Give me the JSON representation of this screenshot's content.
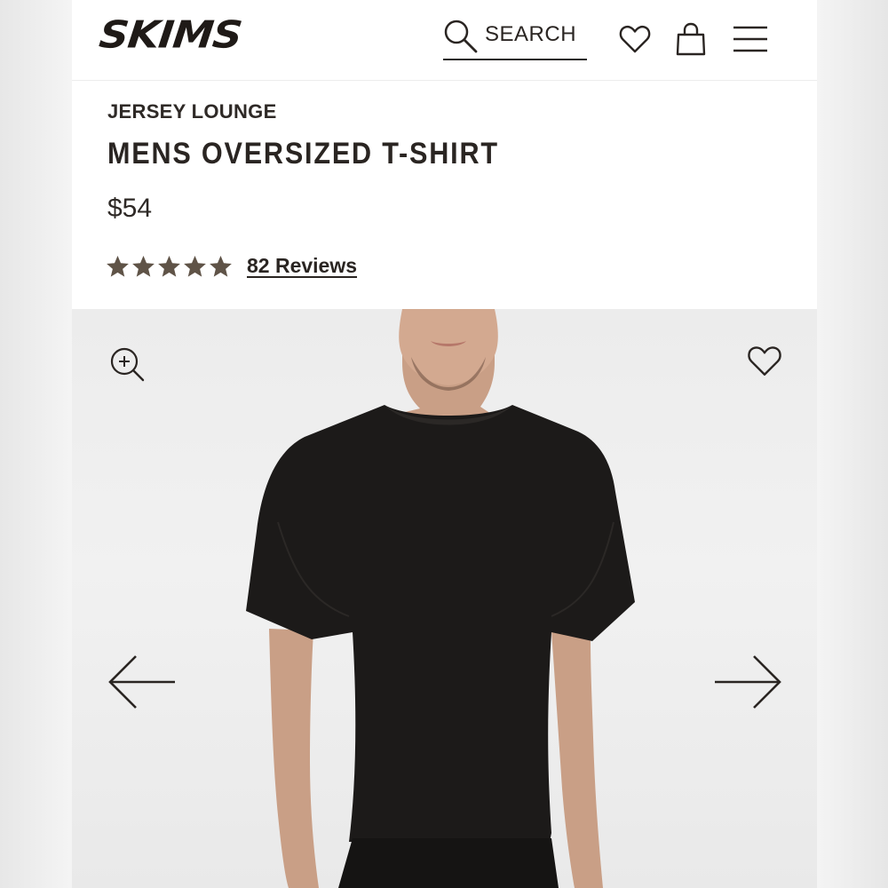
{
  "header": {
    "logo": "SKIMS",
    "search_label": "SEARCH",
    "icons": [
      "search-icon",
      "heart-icon",
      "shopping-bag-icon",
      "menu-icon"
    ]
  },
  "product": {
    "collection": "JERSEY LOUNGE",
    "title": "MENS OVERSIZED T-SHIRT",
    "price": "$54",
    "rating": 5,
    "rating_max": 5,
    "reviews_label": "82 Reviews"
  },
  "gallery": {
    "icons": [
      "zoom-in-icon",
      "heart-icon",
      "arrow-left-icon",
      "arrow-right-icon"
    ]
  },
  "colors": {
    "text": "#2a2522",
    "star": "#5f5347",
    "gallery_bg": "#eeeeee",
    "shirt": "#1c1a19"
  }
}
